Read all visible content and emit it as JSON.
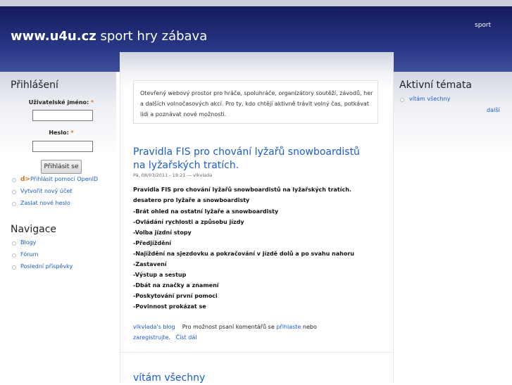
{
  "header": {
    "site_name": "www.u4u.cz",
    "slogan": " sport hry zábava",
    "top_link": "sport"
  },
  "login_block": {
    "title": "Přihlášení",
    "username_label": "Uživatelské jméno: ",
    "password_label": "Heslo: ",
    "required_mark": "*",
    "username_value": "",
    "password_value": "",
    "submit_label": "Přihlásit se",
    "links": [
      "Přihlásit pomocí OpenID",
      "Vytvořit nový účet",
      "Zaslat nové heslo"
    ],
    "openid_icon_glyph": "d>"
  },
  "navigation": {
    "title": "Navigace",
    "items": [
      "Blogy",
      "Fórum",
      "Poslední příspěvky"
    ]
  },
  "active_topics": {
    "title": "Aktivní témata",
    "items": [
      "vítám všechny"
    ],
    "more": "další"
  },
  "intro": {
    "text": "Otevřený webový prostor pro hráče, spoluhráče, organizátory soutěží, závodů, her a dalších volnočasových akcí. Pro ty, kdo chtějí aktivně trávit volný čas, potkávat lidi a poznávat nové možnosti."
  },
  "post": {
    "title": "Pravidla FIS pro chování lyžařů snowboardistů na lyžařských tratích.",
    "meta": "Pá, 08/03/2011 - 19:21 — vlkvlada",
    "lines": [
      "Pravidla FIS pro chování lyžařů snowboardistů na lyžařských tratích.",
      "desatero pro lyžaře a snowboardisty",
      "-Brát ohled na ostatní lyžaře a snowboardisty",
      "-Ovládání rychlosti a způsobu jízdy",
      "-Volba jízdní stopy",
      "-Předjíždění",
      "-Najíždění na sjezdovku a pokračování v jízdě dolů a po svahu nahoru",
      "-Zastavení",
      "-Výstup a sestup",
      "-Dbát na značky a znamení",
      "-Poskytování první pomoci",
      "-Povinnost prokázat se"
    ],
    "blog_link": "vlkvlada's blog",
    "comment_text": "Pro možnost psaní komentářů se ",
    "login_link": "přihlaste",
    "or_text": " nebo",
    "register_link": "zaregistrujte",
    "period": ".",
    "read_more": "Číst dál"
  },
  "post2": {
    "title": "vítám všechny"
  },
  "colors": {
    "header_top": "#141a5c",
    "header_bottom": "#3e4f9c",
    "link": "#1a5ec6",
    "required": "#e07020"
  }
}
